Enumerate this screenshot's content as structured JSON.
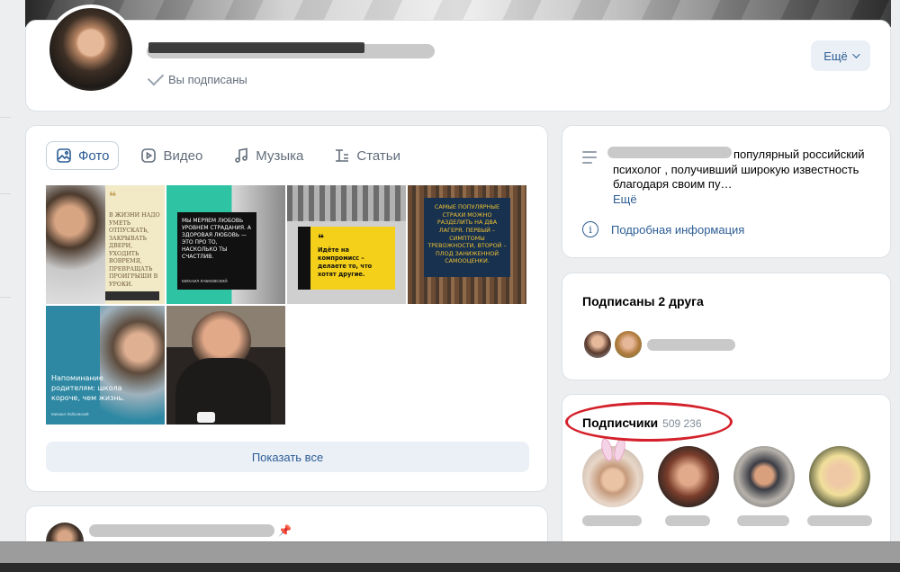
{
  "profile": {
    "subscribed_label": "Вы подписаны",
    "more_button": "Ещё"
  },
  "tabs": [
    {
      "label": "Фото",
      "icon": "photo-icon",
      "active": true
    },
    {
      "label": "Видео",
      "icon": "video-icon",
      "active": false
    },
    {
      "label": "Музыка",
      "icon": "music-icon",
      "active": false
    },
    {
      "label": "Статьи",
      "icon": "articles-icon",
      "active": false
    }
  ],
  "photos": [
    {
      "quote": "В жизни надо уметь отпускать, закрывать двери, уходить вовремя, превращать проигрыши в уроки."
    },
    {
      "quote": "Мы меряем любовь уровнем страдания. А здоровая любовь — это про то, насколько ты счастлив.",
      "author": "Михаил Лабковский"
    },
    {
      "quote": "Идёте на компромисс – делаете то, что хотят другие."
    },
    {
      "quote": "Самые популярные страхи можно разделить на два лагеря. Первый – симптомы тревожности, второй – плод заниженной самооценки."
    },
    {
      "quote": "Напоминание родителям: школа короче, чем жизнь.",
      "author": "Михаил Лабковский"
    },
    {
      "quote": ""
    }
  ],
  "show_all_label": "Показать все",
  "about": {
    "text": "популярный российский психолог , получивший широкую известность благодаря своим пу…",
    "more_link": "Ещё",
    "details_link": "Подробная информация"
  },
  "friends": {
    "title": "Подписаны 2 друга"
  },
  "subscribers": {
    "title": "Подписчики",
    "count": "509 236"
  },
  "colors": {
    "link": "#2c5d94",
    "annotation": "#d4202a"
  }
}
